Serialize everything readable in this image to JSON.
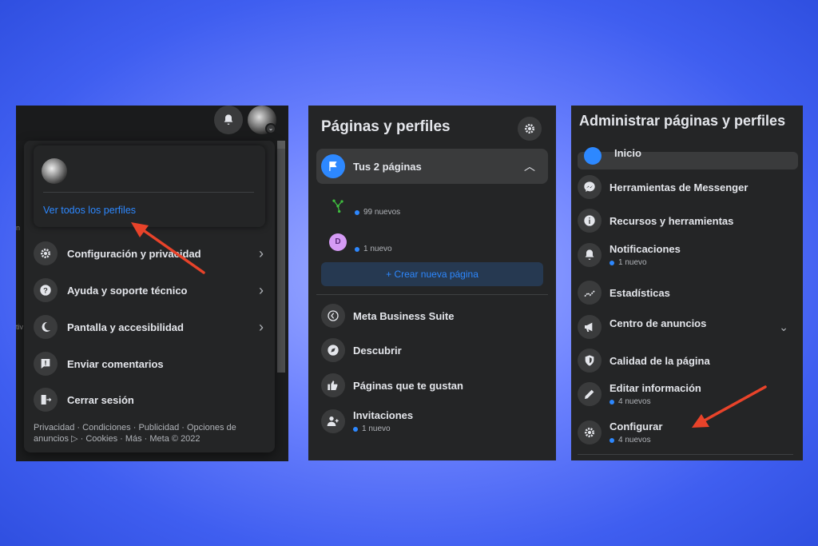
{
  "panel1": {
    "see_all_profiles": "Ver todos los perfiles",
    "menu": [
      {
        "label": "Configuración y privacidad",
        "icon": "gear-icon"
      },
      {
        "label": "Ayuda y soporte técnico",
        "icon": "help-icon"
      },
      {
        "label": "Pantalla y accesibilidad",
        "icon": "moon-icon"
      },
      {
        "label": "Enviar comentarios",
        "icon": "feedback-icon"
      },
      {
        "label": "Cerrar sesión",
        "icon": "logout-icon"
      }
    ],
    "footer": "Privacidad · Condiciones · Publicidad · Opciones de anuncios ▷ · Cookies · Más · Meta © 2022"
  },
  "panel2": {
    "title": "Páginas y perfiles",
    "your_pages": "Tus 2 páginas",
    "pages": [
      {
        "avatar_letter": "",
        "badge": "99 nuevos"
      },
      {
        "avatar_letter": "D",
        "badge": "1 nuevo"
      }
    ],
    "create_page": "+ Crear nueva página",
    "menu": [
      {
        "label": "Meta Business Suite",
        "sub": ""
      },
      {
        "label": "Descubrir",
        "sub": ""
      },
      {
        "label": "Páginas que te gustan",
        "sub": ""
      },
      {
        "label": "Invitaciones",
        "sub": "1 nuevo"
      }
    ]
  },
  "panel3": {
    "title": "Administrar páginas y perfiles",
    "inicio": "Inicio",
    "menu": [
      {
        "label": "Herramientas de Messenger",
        "sub": ""
      },
      {
        "label": "Recursos y herramientas",
        "sub": ""
      },
      {
        "label": "Notificaciones",
        "sub": "1 nuevo"
      },
      {
        "label": "Estadísticas",
        "sub": ""
      },
      {
        "label": "Centro de anuncios",
        "sub": ""
      },
      {
        "label": "Calidad de la página",
        "sub": ""
      },
      {
        "label": "Editar información",
        "sub": "4 nuevos"
      },
      {
        "label": "Configurar",
        "sub": "4 nuevos"
      }
    ]
  },
  "colors": {
    "accent": "#2d88ff",
    "panel_bg": "#242526",
    "arrow": "#e8432a"
  }
}
